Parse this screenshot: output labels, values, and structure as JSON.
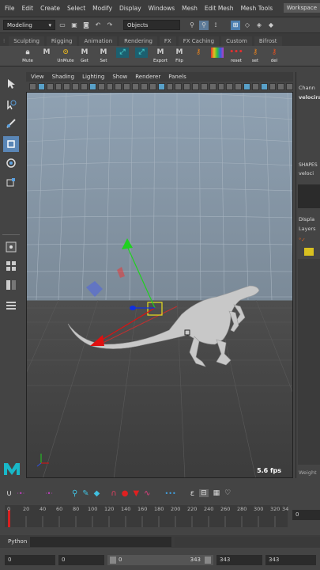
{
  "menubar": {
    "items": [
      "File",
      "Edit",
      "Create",
      "Select",
      "Modify",
      "Display",
      "Windows",
      "Mesh",
      "Edit Mesh",
      "Mesh Tools"
    ],
    "workspace_label": "Workspace"
  },
  "statusline": {
    "mode": "Modeling",
    "selection_mode": "Objects"
  },
  "shelf_tabs": [
    "Sculpting",
    "Rigging",
    "Animation",
    "Rendering",
    "FX",
    "FX Caching",
    "Custom",
    "Bifrost"
  ],
  "shelf_buttons": [
    {
      "label": "Mute",
      "icon": "lock-icon",
      "color": "#dddddd"
    },
    {
      "label": "",
      "icon": "m-logo-icon",
      "color": "#cccccc"
    },
    {
      "label": "UnMute",
      "icon": "unlock-icon",
      "color": "#e0b020"
    },
    {
      "label": "Get",
      "icon": "m-logo-icon",
      "color": "#cccccc"
    },
    {
      "label": "Set",
      "icon": "m-logo-icon",
      "color": "#cccccc"
    },
    {
      "label": "",
      "icon": "curve-icon",
      "color": "#40c0c0"
    },
    {
      "label": "",
      "icon": "curve-icon",
      "color": "#40c0c0"
    },
    {
      "label": "Export",
      "icon": "m-logo-icon",
      "color": "#cccccc"
    },
    {
      "label": "Flip",
      "icon": "m-logo-icon",
      "color": "#cccccc"
    },
    {
      "label": "",
      "icon": "key-icon",
      "color": "#e08020"
    },
    {
      "label": "",
      "icon": "rainbow-icon",
      "color": "#c040c0"
    },
    {
      "label": "reset",
      "icon": "dots-icon",
      "color": "#e03030"
    },
    {
      "label": "set",
      "icon": "key-icon",
      "color": "#e08020"
    },
    {
      "label": "del",
      "icon": "key-icon",
      "color": "#e05020"
    }
  ],
  "panel_menu": [
    "View",
    "Shading",
    "Lighting",
    "Show",
    "Renderer",
    "Panels"
  ],
  "viewport": {
    "fps": "5.6 fps"
  },
  "right_panel": {
    "channel_label": "Chann",
    "object_name": "velocira",
    "shapes_label": "SHAPES",
    "shapes_name": "veloci",
    "display_label": "Displa",
    "layers_label": "Layers",
    "weight_label": "Weight"
  },
  "time_slider": {
    "ticks": [
      "0",
      "20",
      "40",
      "60",
      "80",
      "100",
      "120",
      "140",
      "160",
      "180",
      "200",
      "220",
      "240",
      "260",
      "280",
      "300",
      "320",
      "34"
    ],
    "current_frame": "0"
  },
  "command_line": {
    "label": "Python"
  },
  "range_slider": {
    "start": "0",
    "anim_start": "0",
    "range_start": "0",
    "range_end": "343",
    "anim_end": "343",
    "end": "343"
  },
  "colors": {
    "accent_blue": "#5a86b6",
    "maya_teal": "#18b8c8",
    "manip_red": "#e01010",
    "manip_green": "#20d020",
    "manip_blue": "#1030e0",
    "manip_yellow": "#e8e020"
  }
}
